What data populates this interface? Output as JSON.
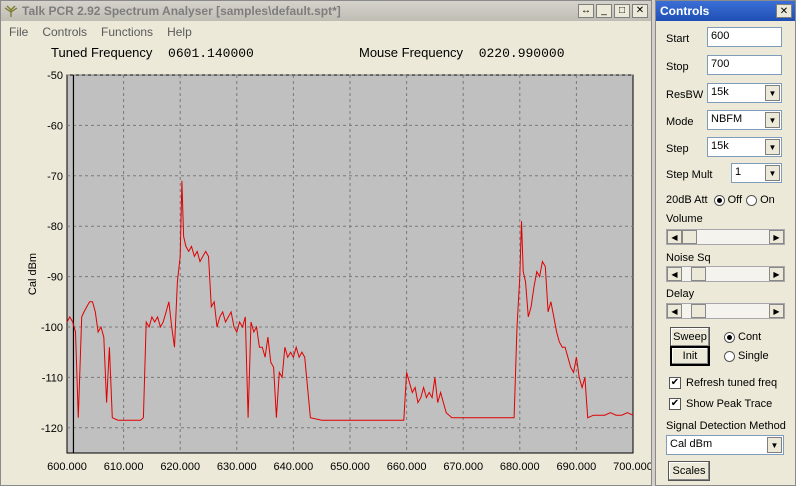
{
  "main_window": {
    "title": "Talk PCR 2.92 Spectrum Analyser [samples\\default.spt*]",
    "menu": [
      "File",
      "Controls",
      "Functions",
      "Help"
    ],
    "buttons": {
      "restore": "↔",
      "minimize": "_",
      "maximize": "□",
      "close": "✕"
    }
  },
  "readouts": {
    "tuned_label": "Tuned Frequency",
    "tuned_value": "0601.140000",
    "mouse_label": "Mouse Frequency",
    "mouse_value": "0220.990000"
  },
  "chart_data": {
    "type": "line",
    "ylabel": "Cal dBm",
    "xlim": [
      600,
      700
    ],
    "ylim": [
      -125,
      -50
    ],
    "x_ticks": [
      "600.000",
      "610.000",
      "620.000",
      "630.000",
      "640.000",
      "650.000",
      "660.000",
      "670.000",
      "680.000",
      "690.000",
      "700.000"
    ],
    "y_ticks": [
      "-50",
      "-60",
      "-70",
      "-80",
      "-90",
      "-100",
      "-110",
      "-120"
    ],
    "grid": true,
    "background": "#c0c0c0",
    "line_color": "#e00000",
    "marker_x": 601.14,
    "series": [
      {
        "x": [
          600,
          600.5,
          601,
          601.5,
          602,
          602.3,
          602.6,
          603,
          603.5,
          604,
          604.5,
          605,
          605.5,
          606,
          606.5,
          607,
          607.5,
          608,
          609,
          610,
          611,
          612,
          613,
          613.5,
          614,
          614.5,
          615,
          615.5,
          616,
          616.5,
          617,
          617.5,
          618,
          618.5,
          619,
          619.5,
          620,
          620.3,
          620.6,
          621,
          621.5,
          622,
          622.5,
          623,
          623.5,
          624,
          624.5,
          625,
          625.5,
          626,
          626.5,
          627,
          627.5,
          628,
          628.5,
          629,
          629.5,
          630,
          630.5,
          631,
          631.5,
          632,
          632.5,
          633,
          633.5,
          634,
          634.5,
          635,
          635.5,
          636,
          636.5,
          637,
          637.5,
          638,
          638.5,
          639,
          639.5,
          640,
          640.5,
          641,
          641.5,
          642,
          643,
          645,
          648,
          650,
          652,
          655,
          656,
          657,
          658,
          659,
          659.5,
          660,
          660.5,
          661,
          661.5,
          662,
          662.5,
          663,
          663.5,
          664,
          664.5,
          665,
          665.5,
          666,
          667,
          668,
          670,
          672,
          674,
          676,
          678,
          679,
          679.5,
          680,
          680.3,
          680.6,
          681,
          681.5,
          682,
          682.5,
          683,
          683.5,
          684,
          684.5,
          685,
          685.5,
          686,
          686.5,
          687,
          687.5,
          688,
          688.5,
          689,
          689.5,
          690,
          690.5,
          691,
          691.5,
          692,
          693,
          694,
          695,
          696,
          697,
          698,
          699,
          700
        ],
        "y": [
          -99,
          -98,
          -99,
          -101,
          -118,
          -108,
          -98,
          -97,
          -96,
          -95,
          -95,
          -97,
          -101,
          -100,
          -102,
          -115,
          -104,
          -118,
          -118.5,
          -118.5,
          -118.5,
          -118.5,
          -118.5,
          -118,
          -99,
          -100,
          -98,
          -99,
          -98,
          -100,
          -99,
          -97,
          -95,
          -100,
          -104,
          -91,
          -86,
          -71,
          -82,
          -84,
          -85,
          -84,
          -86,
          -85,
          -87,
          -86,
          -85,
          -86,
          -96,
          -95,
          -100,
          -98,
          -97,
          -99,
          -98,
          -97,
          -100,
          -101,
          -99,
          -100,
          -98,
          -118,
          -99,
          -101,
          -100,
          -104,
          -104,
          -106,
          -102,
          -107,
          -108,
          -118,
          -109,
          -110,
          -104,
          -106,
          -105,
          -106,
          -104,
          -106,
          -105,
          -106,
          -118,
          -118.5,
          -118.5,
          -118.5,
          -118.5,
          -118.5,
          -118.5,
          -118.5,
          -118.5,
          -118.5,
          -118.5,
          -109,
          -111,
          -113,
          -112,
          -115,
          -114,
          -112,
          -114,
          -113,
          -114,
          -110,
          -115,
          -113,
          -117,
          -118,
          -118,
          -118,
          -118,
          -118,
          -118,
          -118,
          -100,
          -90,
          -79,
          -89,
          -91,
          -98,
          -96,
          -92,
          -89,
          -90,
          -87,
          -88,
          -97,
          -95,
          -98,
          -101,
          -103,
          -104,
          -104,
          -106,
          -108,
          -109,
          -106,
          -110,
          -112,
          -110,
          -118,
          -117.5,
          -117.5,
          -117.5,
          -117,
          -117.5,
          -117.5,
          -117,
          -117.5
        ]
      }
    ]
  },
  "controls_panel": {
    "title": "Controls",
    "close": "✕",
    "start_label": "Start",
    "start_value": "600",
    "stop_label": "Stop",
    "stop_value": "700",
    "resbw_label": "ResBW",
    "resbw_value": "15k",
    "mode_label": "Mode",
    "mode_value": "NBFM",
    "step_label": "Step",
    "step_value": "15k",
    "stepmult_label": "Step Mult",
    "stepmult_value": "1",
    "att_label": "20dB Att",
    "att_off": "Off",
    "att_on": "On",
    "att_selected": "Off",
    "volume_label": "Volume",
    "volume_level": 0.0,
    "noisesq_label": "Noise Sq",
    "noisesq_level": 0.12,
    "delay_label": "Delay",
    "delay_level": 0.12,
    "sweep_button": "Sweep",
    "init_button": "Init",
    "cont_label": "Cont",
    "single_label": "Single",
    "sweep_mode": "Cont",
    "refresh_label": "Refresh tuned freq",
    "refresh_checked": true,
    "peak_label": "Show Peak Trace",
    "peak_checked": true,
    "sigdet_label": "Signal Detection Method",
    "sigdet_value": "Cal dBm",
    "scales_button": "Scales"
  }
}
